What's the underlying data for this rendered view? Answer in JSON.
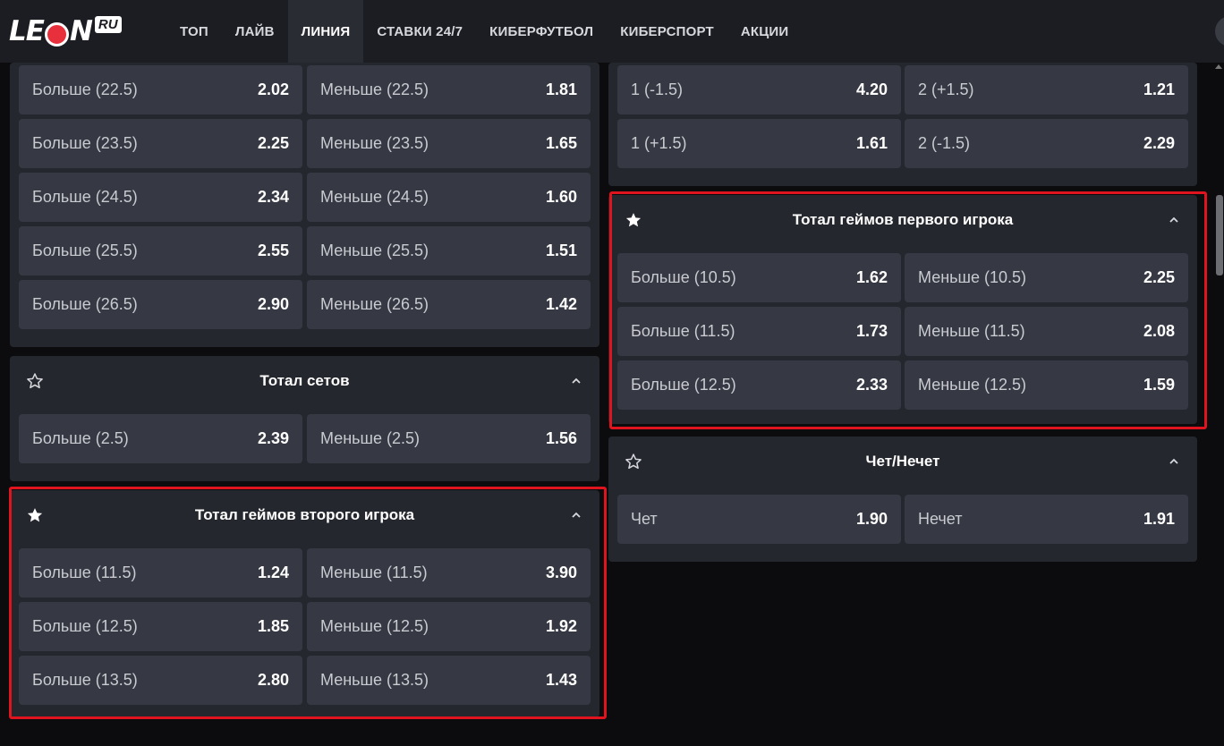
{
  "header": {
    "logo_text_a": "LE",
    "logo_text_b": "N",
    "logo_badge": "RU",
    "nav": [
      "ТОП",
      "ЛАЙВ",
      "ЛИНИЯ",
      "СТАВКИ 24/7",
      "КИБЕРФУТБОЛ",
      "КИБЕРСПОРТ",
      "АКЦИИ"
    ],
    "active_nav": "ЛИНИЯ"
  },
  "left_top_rows": [
    {
      "a_label": "Больше (22.5)",
      "a_odd": "2.02",
      "b_label": "Меньше (22.5)",
      "b_odd": "1.81"
    },
    {
      "a_label": "Больше (23.5)",
      "a_odd": "2.25",
      "b_label": "Меньше (23.5)",
      "b_odd": "1.65"
    },
    {
      "a_label": "Больше (24.5)",
      "a_odd": "2.34",
      "b_label": "Меньше (24.5)",
      "b_odd": "1.60"
    },
    {
      "a_label": "Больше (25.5)",
      "a_odd": "2.55",
      "b_label": "Меньше (25.5)",
      "b_odd": "1.51"
    },
    {
      "a_label": "Больше (26.5)",
      "a_odd": "2.90",
      "b_label": "Меньше (26.5)",
      "b_odd": "1.42"
    }
  ],
  "total_sets": {
    "title": "Тотал сетов",
    "rows": [
      {
        "a_label": "Больше (2.5)",
        "a_odd": "2.39",
        "b_label": "Меньше (2.5)",
        "b_odd": "1.56"
      }
    ]
  },
  "second_player": {
    "title": "Тотал геймов второго игрока",
    "rows": [
      {
        "a_label": "Больше (11.5)",
        "a_odd": "1.24",
        "b_label": "Меньше (11.5)",
        "b_odd": "3.90"
      },
      {
        "a_label": "Больше (12.5)",
        "a_odd": "1.85",
        "b_label": "Меньше (12.5)",
        "b_odd": "1.92"
      },
      {
        "a_label": "Больше (13.5)",
        "a_odd": "2.80",
        "b_label": "Меньше (13.5)",
        "b_odd": "1.43"
      }
    ]
  },
  "right_top_rows": [
    {
      "a_label": "1 (-1.5)",
      "a_odd": "4.20",
      "b_label": "2 (+1.5)",
      "b_odd": "1.21"
    },
    {
      "a_label": "1 (+1.5)",
      "a_odd": "1.61",
      "b_label": "2 (-1.5)",
      "b_odd": "2.29"
    }
  ],
  "first_player": {
    "title": "Тотал геймов первого игрока",
    "rows": [
      {
        "a_label": "Больше (10.5)",
        "a_odd": "1.62",
        "b_label": "Меньше (10.5)",
        "b_odd": "2.25"
      },
      {
        "a_label": "Больше (11.5)",
        "a_odd": "1.73",
        "b_label": "Меньше (11.5)",
        "b_odd": "2.08"
      },
      {
        "a_label": "Больше (12.5)",
        "a_odd": "2.33",
        "b_label": "Меньше (12.5)",
        "b_odd": "1.59"
      }
    ]
  },
  "odd_even": {
    "title": "Чет/Нечет",
    "rows": [
      {
        "a_label": "Чет",
        "a_odd": "1.90",
        "b_label": "Нечет",
        "b_odd": "1.91"
      }
    ]
  },
  "colors": {
    "highlight": "#e0141e",
    "logo_red": "#e8303c",
    "panel": "#25272e",
    "cell": "#363943"
  },
  "icons": {
    "favorite_filled": "star-filled-icon",
    "favorite_empty": "star-outline-icon",
    "collapse": "chevron-up-icon"
  }
}
